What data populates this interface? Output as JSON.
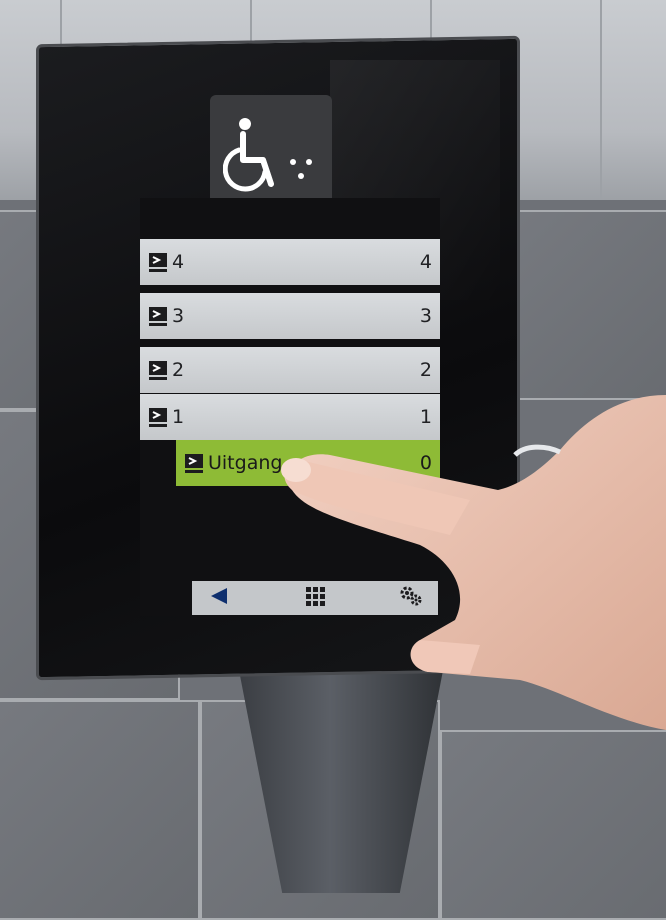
{
  "scene": {
    "colors": {
      "screen_bg": "#101012",
      "row_bg": "#d0d3d6",
      "row_selected": "#8ebb36",
      "toolbar_bg": "#c4c7ca"
    }
  },
  "kiosk": {
    "accessibility_icon": "wheelchair-icon",
    "floors": [
      {
        "label": "4",
        "number": "4",
        "selected": false
      },
      {
        "label": "3",
        "number": "3",
        "selected": false
      },
      {
        "label": "2",
        "number": "2",
        "selected": false
      },
      {
        "label": "1",
        "number": "1",
        "selected": false
      },
      {
        "label": "Uitgang",
        "number": "0",
        "selected": true
      }
    ],
    "toolbar": {
      "back_icon": "back-arrow-icon",
      "keypad_icon": "keypad-icon",
      "settings_icon": "gears-icon"
    }
  }
}
